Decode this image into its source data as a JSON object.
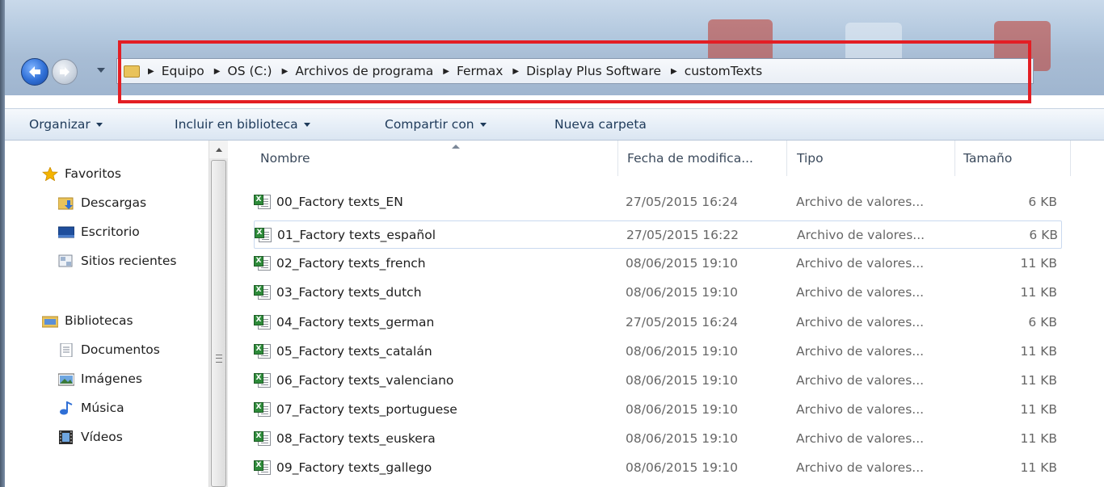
{
  "address": {
    "crumbs": [
      "Equipo",
      "OS (C:)",
      "Archivos de programa",
      "Fermax",
      "Display Plus Software",
      "customTexts"
    ]
  },
  "toolbar": {
    "organize": "Organizar",
    "include_library": "Incluir en biblioteca",
    "share_with": "Compartir con",
    "new_folder": "Nueva carpeta"
  },
  "navpane": {
    "favorites": "Favoritos",
    "downloads": "Descargas",
    "desktop": "Escritorio",
    "recent": "Sitios recientes",
    "libraries": "Bibliotecas",
    "documents": "Documentos",
    "images": "Imágenes",
    "music": "Música",
    "videos": "Vídeos"
  },
  "columns": {
    "name": "Nombre",
    "date": "Fecha de modifica...",
    "type": "Tipo",
    "size": "Tamaño"
  },
  "files": [
    {
      "name": "00_Factory texts_EN",
      "date": "27/05/2015 16:24",
      "type": "Archivo de valores...",
      "size": "6 KB"
    },
    {
      "name": "01_Factory texts_español",
      "date": "27/05/2015 16:22",
      "type": "Archivo de valores...",
      "size": "6 KB"
    },
    {
      "name": "02_Factory texts_french",
      "date": "08/06/2015 19:10",
      "type": "Archivo de valores...",
      "size": "11 KB"
    },
    {
      "name": "03_Factory texts_dutch",
      "date": "08/06/2015 19:10",
      "type": "Archivo de valores...",
      "size": "11 KB"
    },
    {
      "name": "04_Factory texts_german",
      "date": "27/05/2015 16:24",
      "type": "Archivo de valores...",
      "size": "6 KB"
    },
    {
      "name": "05_Factory texts_catalán",
      "date": "08/06/2015 19:10",
      "type": "Archivo de valores...",
      "size": "11 KB"
    },
    {
      "name": "06_Factory texts_valenciano",
      "date": "08/06/2015 19:10",
      "type": "Archivo de valores...",
      "size": "11 KB"
    },
    {
      "name": "07_Factory texts_portuguese",
      "date": "08/06/2015 19:10",
      "type": "Archivo de valores...",
      "size": "11 KB"
    },
    {
      "name": "08_Factory texts_euskera",
      "date": "08/06/2015 19:10",
      "type": "Archivo de valores...",
      "size": "11 KB"
    },
    {
      "name": "09_Factory texts_gallego",
      "date": "08/06/2015 19:10",
      "type": "Archivo de valores...",
      "size": "11 KB"
    }
  ],
  "file_icon": "csv-excel-icon",
  "colors": {
    "highlight": "#e31e24",
    "toolbar_text": "#1e3a5a",
    "secondary_text": "#666666"
  }
}
